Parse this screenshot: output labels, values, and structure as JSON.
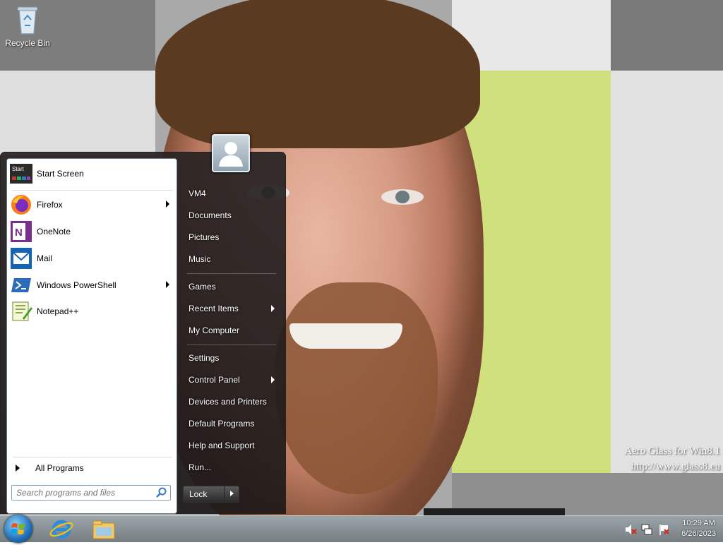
{
  "desktop": {
    "recycle_bin_label": "Recycle Bin",
    "watermark_line1": "Aero Glass for Win8.1",
    "watermark_line2": "http://www.glass8.eu"
  },
  "start_menu": {
    "pinned": [
      {
        "label": "Start Screen",
        "icon": "start-screen-icon",
        "has_submenu": false
      },
      {
        "label": "Firefox",
        "icon": "firefox-icon",
        "has_submenu": true
      },
      {
        "label": "OneNote",
        "icon": "onenote-icon",
        "has_submenu": false
      },
      {
        "label": "Mail",
        "icon": "mail-icon",
        "has_submenu": false
      },
      {
        "label": "Windows PowerShell",
        "icon": "powershell-icon",
        "has_submenu": true
      },
      {
        "label": "Notepad++",
        "icon": "notepadpp-icon",
        "has_submenu": false
      }
    ],
    "start_screen_tile_text": "Start",
    "all_programs_label": "All Programs",
    "search_placeholder": "Search programs and files",
    "right": [
      {
        "label": "VM4",
        "has_submenu": false
      },
      {
        "label": "Documents",
        "has_submenu": false
      },
      {
        "label": "Pictures",
        "has_submenu": false
      },
      {
        "label": "Music",
        "has_submenu": false
      },
      {
        "label": "Games",
        "has_submenu": false
      },
      {
        "label": "Recent Items",
        "has_submenu": true
      },
      {
        "label": "My Computer",
        "has_submenu": false
      },
      {
        "label": "Settings",
        "has_submenu": false
      },
      {
        "label": "Control Panel",
        "has_submenu": true
      },
      {
        "label": "Devices and Printers",
        "has_submenu": false
      },
      {
        "label": "Default Programs",
        "has_submenu": false
      },
      {
        "label": "Help and Support",
        "has_submenu": false
      },
      {
        "label": "Run...",
        "has_submenu": false
      }
    ],
    "lock_label": "Lock"
  },
  "taskbar": {
    "pinned": [
      "start-orb",
      "internet-explorer-icon",
      "file-explorer-icon"
    ],
    "clock_time": "10:29 AM",
    "clock_date": "6/26/2023"
  },
  "colors": {
    "accent": "#1f6fb7",
    "start_menu_bg": "#282323",
    "left_pane_bg": "#ffffff"
  }
}
